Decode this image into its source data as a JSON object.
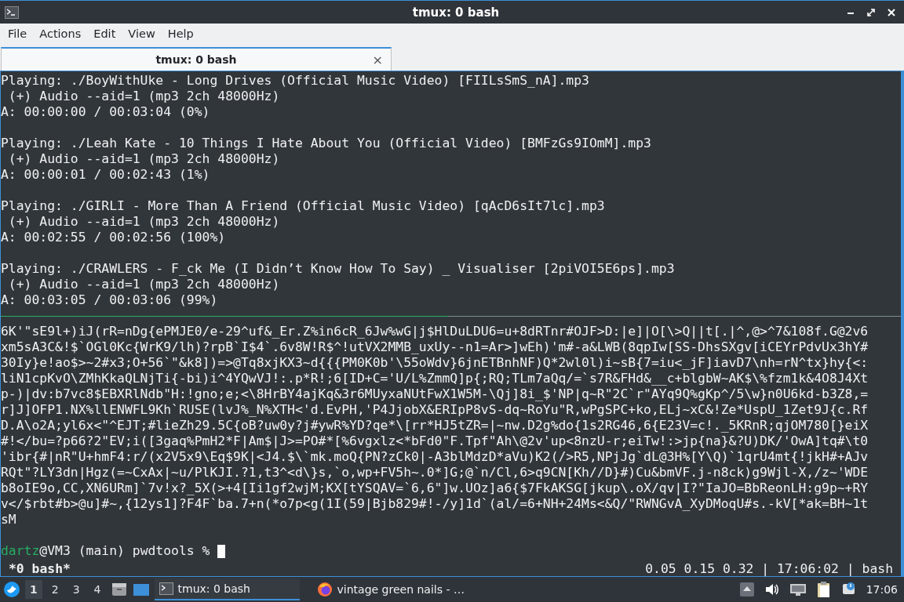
{
  "window": {
    "title": "tmux: 0 bash"
  },
  "menu": [
    "File",
    "Actions",
    "Edit",
    "View",
    "Help"
  ],
  "tabs": [
    {
      "label": "tmux: 0 bash",
      "selected": true,
      "close": "×"
    }
  ],
  "upper_pane": {
    "tracks": [
      {
        "playing": "Playing: ./BoyWithUke - Long Drives (Official Music Video) [FIILsSmS_nA].mp3",
        "audio": " (+) Audio --aid=1 (mp3 2ch 48000Hz)",
        "time": "A: 00:00:00 / 00:03:04 (0%)"
      },
      {
        "playing": "Playing: ./Leah Kate - 10 Things I Hate About You (Official Video) [BMFzGs9IOmM].mp3",
        "audio": " (+) Audio --aid=1 (mp3 2ch 48000Hz)",
        "time": "A: 00:00:01 / 00:02:43 (1%)"
      },
      {
        "playing": "Playing: ./GIRLI - More Than A Friend (Official Music Video) [qAcD6sIt7lc].mp3",
        "audio": " (+) Audio --aid=1 (mp3 2ch 48000Hz)",
        "time": "A: 00:02:55 / 00:02:56 (100%)"
      },
      {
        "playing": "Playing: ./CRAWLERS - F_ck Me (I Didn’t Know How To Say) _ Visualiser [2piVOI5E6ps].mp3",
        "audio": " (+) Audio --aid=1 (mp3 2ch 48000Hz)",
        "time": "A: 00:03:05 / 00:03:06 (99%)"
      }
    ]
  },
  "lower_pane": {
    "lines": [
      "6K'\"sE9l+)iJ(rR=nDg{ePMJE0/e-29^uf&_Er.Z%in6cR_6Jw%wG|j$HlDuLDU6=u+8dRTnr#OJF>D:|e]|O[\\>Q||t[.|^,@>^7&108f.G@2v6",
      "xm5sA3C&!$`OGl0Kc{WrK9/lh)?rpB`I$4`.6v8W!R$^!utVX2MMB_uxUy--n1=Ar>]wEh)'m#-a&LWB(8qpIw[SS-DhsSXgv[iCEYrPdvUx3hY#",
      "30Iy}e!ao$>~2#x3;O+56`\"&k8])=>@Tq8xjKX3~d{{{PM0K0b'\\55oWdv}6jnETBnhNF)Q*2wl0l)i~sB{7=iu<_jF]iavD7\\nh=rN^tx}hy{<:",
      "liN1cpKvO\\ZMhKkaQLNjTi{-bi)i^4YQwVJ!:.p*R!;6[ID+C='U/L%ZmmQ]p{;RQ;TLm7aQq/=`s7R&FHd&__c+blgbW~AK$\\%fzm1k&4O8J4Xt",
      "p-)|dv:b7vc8$EBXRlNdb\"H:!gno;e;<\\8HrBY4ajKq&3r6MUyxaNUtFwX1W5M-\\Qj]8i_$'NP|q~R\"2C`r\"AYq9Q%gKp^/5\\w}n0U6kd-b3Z8,=",
      "r]J]OFP1.NX%llENWFL9Kh`RUSE(lvJ%_N%XTH<'d.EvPH,'P4JjobX&ERIpP8vS-dq~RoYu\"R,wPgSPC+ko,ELj~xC&!Ze*UspU_1Zet9J{c.Rf",
      "D.A\\o2A;yl6x<\"^EJT;#lieZh29.5C{oB?uw0y?j#ywR%YD?qe*\\[rr*HJ5tZR=|~nw.D2g%do{1s2RG46,6{E23V=c!._5KRnR;qjOM780[}eiX",
      "#!</bu=?p66?2\"EV;i([3gaq%PmH2*F|Am$|J>=PO#*[%6vgxlz<*bFd0\"F.Tpf\"Ah\\@2v'up<8nzU-r;eiTw!:>jp{na}&?U)DK/'OwA]tq#\\t0",
      "'ibr{#|nR\"U+hmF4:r/(x2V5x9\\Eq$9K|<J4.$\\`mk.moQ{PN?zCk0|-A3blMdzD*aVu)K2(/>R5,NPjJg`dL@3H%[Y\\Q)`1qrU4mt{!jkH#+AJv",
      "RQt\"?LY3dn|Hgz(=~CxAx|~u/PlKJI.?1,t3^<d\\}s,`o,wp+FV5h~.0*]G;@`n/Cl,6>q9CN[Kh//D}#)Cu&bmVF.j-n8ck)g9Wjl-X,/z~'WDE",
      "b8oIE9o,CC,XN6URm]`7v!x?_5X(>+4[Ii1gf2wjM;KX[tYSQAV=`6,6\"]w.UOz]a6{$7FkAKSG[jkup\\.oX/qv|I?\"IaJO=BbReonLH:g9p~+RY",
      "v</$rbt#b>@u]#~,{12ys1]?F4F`ba.7+n(*o7p<g(1I(59|Bjb829#!-/y]1d`(al/=6+NH+24Ms<&Q/\"RWNGvA_XyDMoqU#s.-kV[*ak=BH~1t",
      "sM"
    ]
  },
  "prompt": {
    "user": "dartz",
    "text": "@VM3 (main) pwdtools % "
  },
  "tmux_status": {
    "left": "*0 bash*",
    "right": "0.05 0.15 0.32 | 17:06:02 | bash"
  },
  "taskbar": {
    "workspaces": [
      {
        "label": "1",
        "selected": true
      },
      {
        "label": "2",
        "selected": false
      },
      {
        "label": "3",
        "selected": false
      },
      {
        "label": "4",
        "selected": false
      }
    ],
    "tasks": [
      {
        "kind": "terminal",
        "label": "tmux: 0 bash",
        "selected": true
      },
      {
        "kind": "browser",
        "label": "vintage green nails - …",
        "selected": false
      }
    ],
    "clock": "17:06"
  }
}
